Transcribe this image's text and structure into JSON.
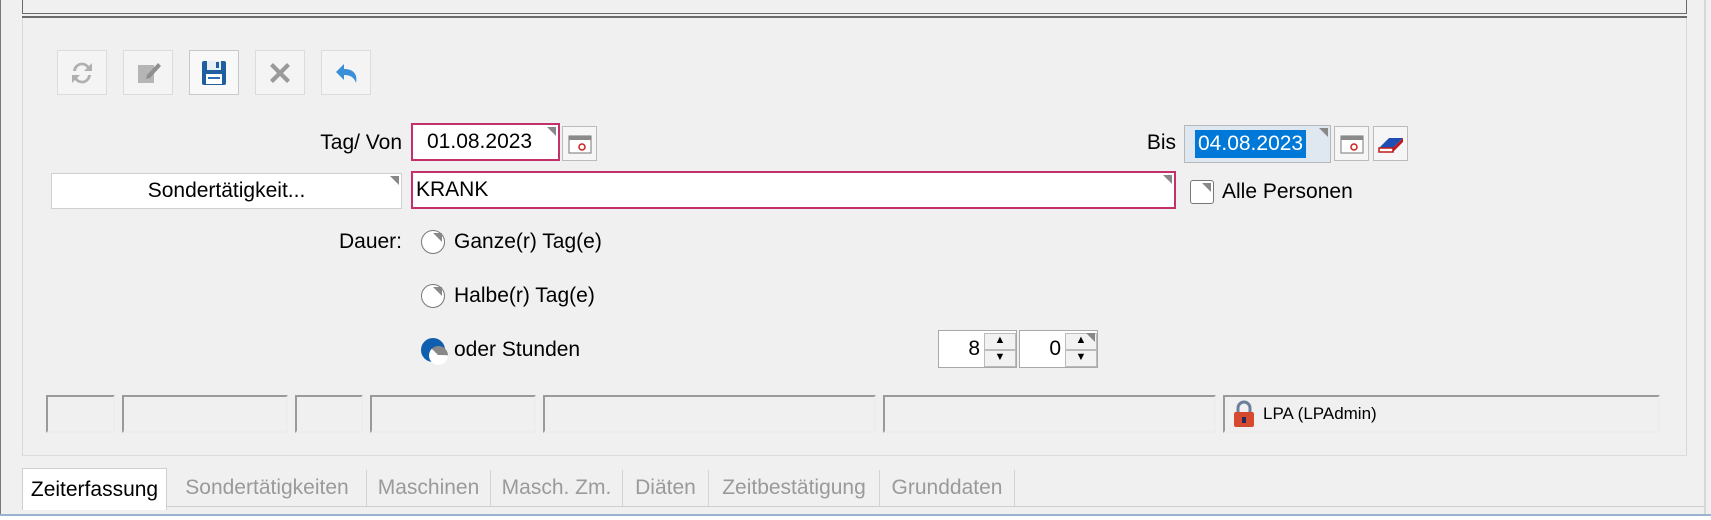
{
  "toolbar": {
    "buttons": [
      {
        "name": "refresh",
        "icon": "refresh-icon",
        "enabled": false
      },
      {
        "name": "edit",
        "icon": "edit-icon",
        "enabled": false
      },
      {
        "name": "save",
        "icon": "save-icon",
        "enabled": true
      },
      {
        "name": "delete",
        "icon": "delete-icon",
        "enabled": false
      },
      {
        "name": "undo",
        "icon": "undo-icon",
        "enabled": true
      }
    ]
  },
  "form": {
    "tag_von_label": "Tag/ Von",
    "tag_von_value": "01.08.2023",
    "bis_label": "Bis",
    "bis_value": "04.08.2023",
    "sondertaetigkeit_button": "Sondertätigkeit...",
    "sondertaetigkeit_value": "KRANK",
    "alle_personen_label": "Alle Personen",
    "alle_personen_checked": false,
    "dauer_label": "Dauer:",
    "options": [
      {
        "label": "Ganze(r) Tag(e)",
        "selected": false
      },
      {
        "label": "Halbe(r) Tag(e)",
        "selected": false
      },
      {
        "label": "oder Stunden",
        "selected": true
      }
    ],
    "hours": "8",
    "minutes": "0"
  },
  "statusbar": {
    "user": "LPA (LPAdmin)"
  },
  "tabs": [
    {
      "label": "Zeiterfassung",
      "active": true
    },
    {
      "label": "Sondertätigkeiten",
      "active": false
    },
    {
      "label": "Maschinen",
      "active": false
    },
    {
      "label": "Masch. Zm.",
      "active": false
    },
    {
      "label": "Diäten",
      "active": false
    },
    {
      "label": "Zeitbestätigung",
      "active": false
    },
    {
      "label": "Grunddaten",
      "active": false
    }
  ],
  "colors": {
    "required_border": "#c4306a",
    "selection": "#0078d7",
    "radio_selected": "#0f5fb0"
  }
}
